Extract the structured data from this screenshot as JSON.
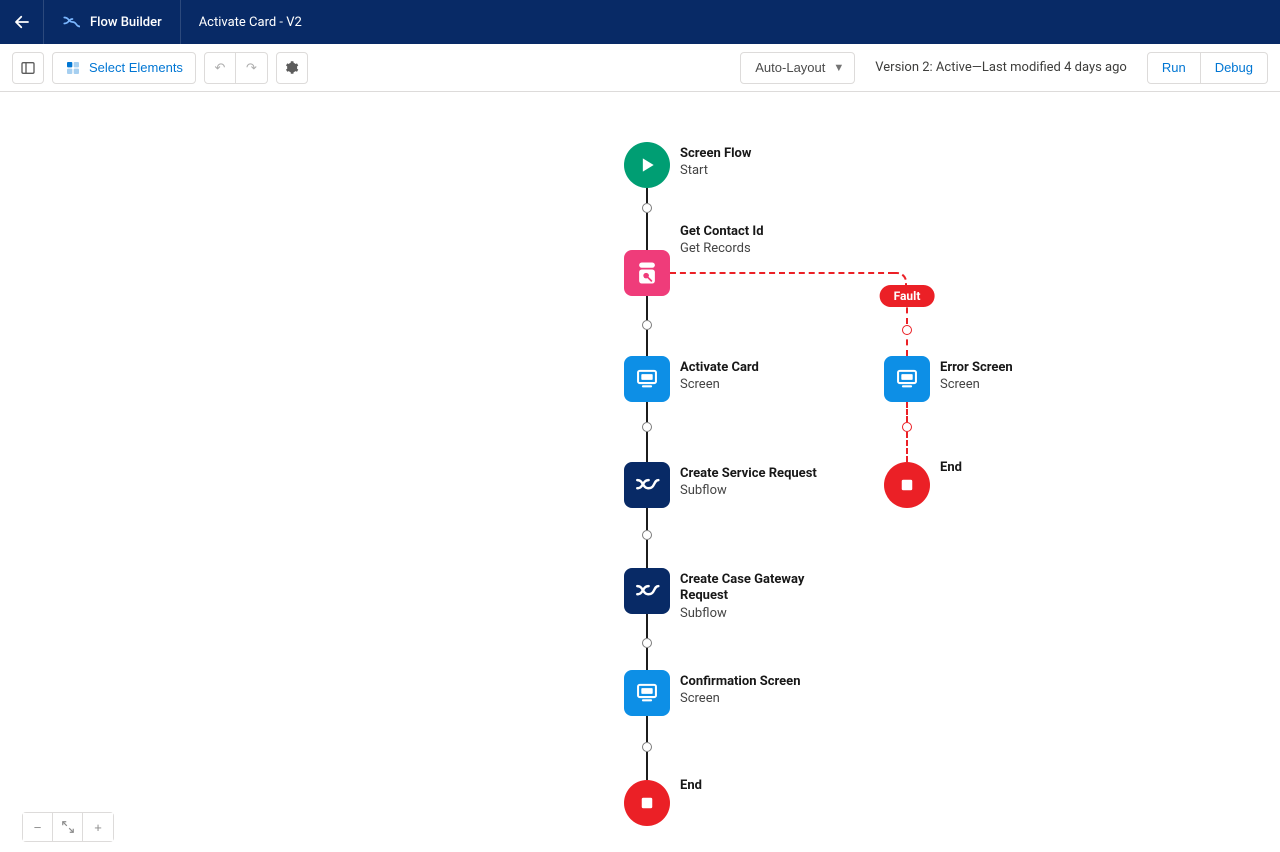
{
  "header": {
    "app_name": "Flow Builder",
    "flow_title": "Activate Card - V2"
  },
  "toolbar": {
    "select_elements": "Select Elements",
    "layout_mode": "Auto-Layout",
    "status": "Version 2: Active—Last modified 4 days ago",
    "run": "Run",
    "debug": "Debug"
  },
  "fault_label": "Fault",
  "nodes": {
    "start": {
      "title": "Screen Flow",
      "subtitle": "Start"
    },
    "getrec": {
      "title": "Get Contact Id",
      "subtitle": "Get Records"
    },
    "activate": {
      "title": "Activate Card",
      "subtitle": "Screen"
    },
    "svc": {
      "title": "Create Service Request",
      "subtitle": "Subflow"
    },
    "gateway": {
      "title": "Create Case Gateway Request",
      "subtitle": "Subflow"
    },
    "confirm": {
      "title": "Confirmation Screen",
      "subtitle": "Screen"
    },
    "end_main": {
      "title": "End"
    },
    "error": {
      "title": "Error Screen",
      "subtitle": "Screen"
    },
    "end_err": {
      "title": "End"
    }
  }
}
